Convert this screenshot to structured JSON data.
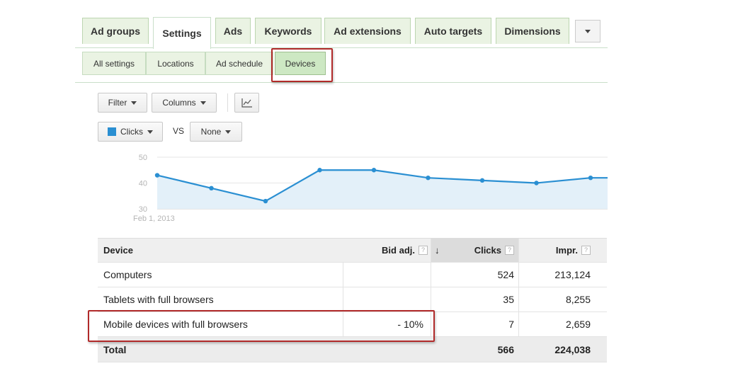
{
  "top_tabs": [
    {
      "label": "Ad groups"
    },
    {
      "label": "Settings"
    },
    {
      "label": "Ads"
    },
    {
      "label": "Keywords"
    },
    {
      "label": "Ad extensions"
    },
    {
      "label": "Auto targets"
    },
    {
      "label": "Dimensions"
    }
  ],
  "sub_tabs": [
    {
      "label": "All settings"
    },
    {
      "label": "Locations"
    },
    {
      "label": "Ad schedule"
    },
    {
      "label": "Devices"
    }
  ],
  "toolbar": {
    "filter_label": "Filter",
    "columns_label": "Columns",
    "metric1_label": "Clicks",
    "vs_label": "VS",
    "metric2_label": "None"
  },
  "colors": {
    "accent": "#2a8fd2",
    "highlight": "#b12a2a",
    "tab_green": "#eaf3e3"
  },
  "chart_data": {
    "type": "area",
    "y_ticks": [
      "50",
      "40",
      "30"
    ],
    "x_start_label": "Feb 1, 2013",
    "ylim": [
      30,
      50
    ],
    "values": [
      43,
      38,
      33,
      45,
      45,
      42,
      41,
      40,
      42,
      42
    ],
    "series": [
      {
        "name": "Clicks"
      }
    ]
  },
  "table": {
    "headers": {
      "device": "Device",
      "bid_adj": "Bid adj.",
      "clicks": "Clicks",
      "impr": "Impr.",
      "help": "?"
    },
    "rows": [
      {
        "device": "Computers",
        "bid_adj": "",
        "clicks": "524",
        "impr": "213,124"
      },
      {
        "device": "Tablets with full browsers",
        "bid_adj": "",
        "clicks": "35",
        "impr": "8,255"
      },
      {
        "device": "Mobile devices with full browsers",
        "bid_adj": "- 10%",
        "clicks": "7",
        "impr": "2,659"
      }
    ],
    "total": {
      "device": "Total",
      "clicks": "566",
      "impr": "224,038"
    }
  }
}
